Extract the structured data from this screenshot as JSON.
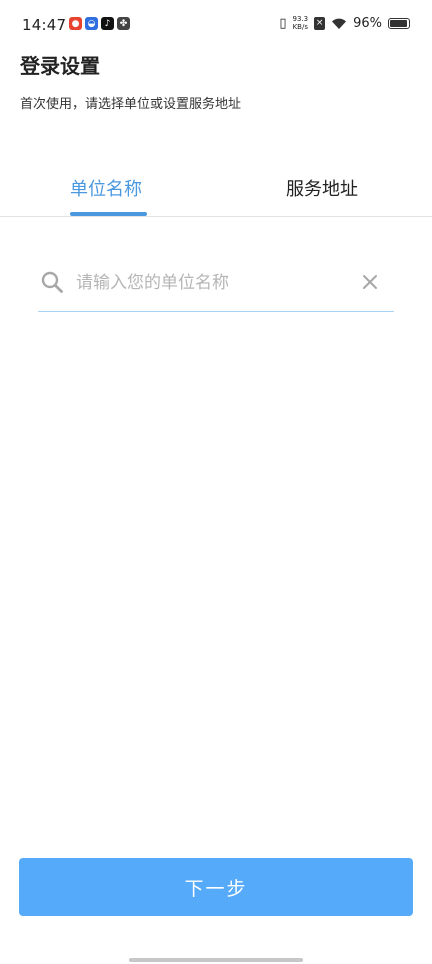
{
  "status_bar": {
    "time": "14:47",
    "net_speed_value": "93.3",
    "net_speed_unit": "KB/s",
    "battery": "96%",
    "app_icons": [
      "weibo-icon",
      "baidu-icon",
      "douyin-icon",
      "clover-icon"
    ]
  },
  "header": {
    "title": "登录设置",
    "subtitle": "首次使用，请选择单位或设置服务地址"
  },
  "tabs": [
    {
      "label": "单位名称",
      "active": true
    },
    {
      "label": "服务地址",
      "active": false
    }
  ],
  "search": {
    "placeholder": "请输入您的单位名称",
    "value": ""
  },
  "footer": {
    "next_label": "下一步"
  },
  "colors": {
    "accent": "#4a98e0",
    "button": "#55aaf9",
    "input_underline": "#a9d3f2"
  }
}
